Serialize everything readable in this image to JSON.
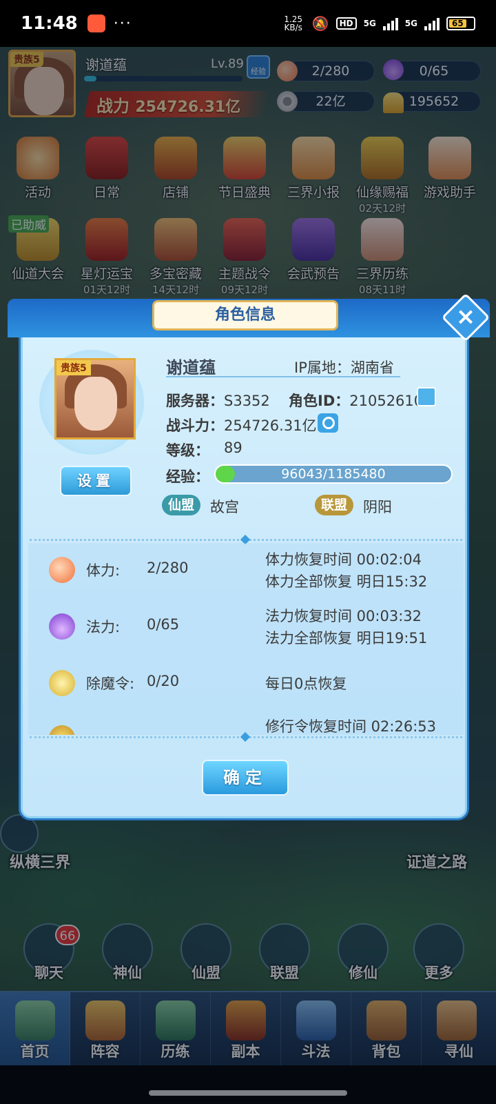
{
  "status_bar": {
    "time": "11:48",
    "more": "···",
    "net_speed": "1.25 KB/s",
    "hd": "HD",
    "net1": "5G",
    "net2": "5G",
    "battery": "65"
  },
  "player": {
    "noble": "贵族5",
    "name": "谢道蕴",
    "level": "Lv.89",
    "exp_btn": "经验",
    "power_label": "战力",
    "power_value": "254726.31亿"
  },
  "resources": [
    {
      "icon": "peach-icon",
      "value": "2/280"
    },
    {
      "icon": "mana-flame-icon",
      "value": "0/65"
    },
    {
      "icon": "coin-icon",
      "value": "22亿"
    },
    {
      "icon": "gold-ingot-icon",
      "value": "195652"
    }
  ],
  "grid_row1": [
    {
      "label": "活动",
      "time": ""
    },
    {
      "label": "日常",
      "time": ""
    },
    {
      "label": "店铺",
      "time": ""
    },
    {
      "label": "节日盛典",
      "time": ""
    },
    {
      "label": "三界小报",
      "time": ""
    },
    {
      "label": "仙缘赐福",
      "time": "02天12时"
    },
    {
      "label": "游戏助手",
      "time": ""
    }
  ],
  "grid_row2": [
    {
      "label": "仙道大会",
      "time": "",
      "tag": "已助威"
    },
    {
      "label": "星灯运宝",
      "time": "01天12时"
    },
    {
      "label": "多宝密藏",
      "time": "14天12时"
    },
    {
      "label": "主题战令",
      "time": "09天12时"
    },
    {
      "label": "会武预告",
      "time": ""
    },
    {
      "label": "三界历练",
      "time": "08天11时"
    }
  ],
  "modal": {
    "title": "角色信息",
    "close": "×",
    "noble": "贵族5",
    "settings_btn": "设置",
    "name": "谢道蕴",
    "ip_label": "IP属地：",
    "ip_value": "湖南省",
    "server_label": "服务器：",
    "server_value": "S3352",
    "role_id_label": "角色ID：",
    "role_id_value": "21052610",
    "power_label": "战斗力：",
    "power_value": "254726.31亿",
    "level_label": "等级：",
    "level_value": "89",
    "exp_label": "经验：",
    "exp_value": "96043/1185480",
    "exp_fraction": 0.081,
    "guild_tag": "仙盟",
    "guild_value": "故宫",
    "alliance_tag": "联盟",
    "alliance_value": "阴阳",
    "stats": [
      {
        "label": "体力:",
        "value": "2/280",
        "line1": "体力恢复时间 00:02:04",
        "line2": "体力全部恢复 明日15:32"
      },
      {
        "label": "法力:",
        "value": "0/65",
        "line1": "法力恢复时间 00:03:32",
        "line2": "法力全部恢复 明日19:51"
      },
      {
        "label": "除魔令:",
        "value": "0/20",
        "line1": "每日0点恢复",
        "line2": ""
      },
      {
        "label": "",
        "value": "",
        "line1": "修行令恢复时间 02:26:53",
        "line2": ""
      }
    ],
    "ok_btn": "确定"
  },
  "side": {
    "left": "纵横三界",
    "right": "证道之路"
  },
  "circle_buttons": [
    {
      "label": "聊天"
    },
    {
      "label": "神仙"
    },
    {
      "label": "仙盟"
    },
    {
      "label": "联盟"
    },
    {
      "label": "修仙"
    },
    {
      "label": "更多"
    }
  ],
  "chat_badge": "66",
  "nav": [
    {
      "label": "首页"
    },
    {
      "label": "阵容"
    },
    {
      "label": "历练"
    },
    {
      "label": "副本"
    },
    {
      "label": "斗法"
    },
    {
      "label": "背包"
    },
    {
      "label": "寻仙"
    }
  ],
  "colors": {
    "accent": "#2f92e0",
    "power_red": "#c8321f",
    "gold": "#e3a93a",
    "exp_green": "#5fd64a"
  }
}
